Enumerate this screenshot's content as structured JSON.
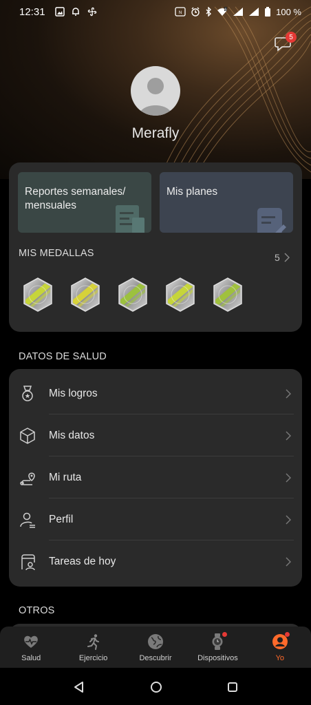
{
  "status_bar": {
    "time": "12:31",
    "battery": "100 %",
    "icons": [
      "gallery-icon",
      "notification-bell-icon",
      "fan-icon",
      "nfc-icon",
      "alarm-icon",
      "bluetooth-icon",
      "wifi-icon",
      "signal-icon",
      "battery-icon"
    ]
  },
  "messages": {
    "badge_count": "5"
  },
  "profile": {
    "name": "Merafly"
  },
  "tiles": {
    "reports_label": "Reportes semanales/ mensuales",
    "plans_label": "Mis planes"
  },
  "medals": {
    "title": "MIS MEDALLAS",
    "count": "5",
    "items": [
      {
        "name": "medal-1",
        "accent": "#c6d53a"
      },
      {
        "name": "medal-300",
        "accent": "#d6d23a"
      },
      {
        "name": "medal-100",
        "accent": "#9cc13e"
      },
      {
        "name": "medal-10",
        "accent": "#c6d53a"
      },
      {
        "name": "medal-1000",
        "accent": "#a0c13e"
      }
    ]
  },
  "health": {
    "title": "DATOS DE SALUD",
    "items": [
      {
        "label": "Mis logros",
        "icon": "medal-icon"
      },
      {
        "label": "Mis datos",
        "icon": "cube-icon"
      },
      {
        "label": "Mi ruta",
        "icon": "route-icon"
      },
      {
        "label": "Perfil",
        "icon": "person-icon"
      },
      {
        "label": "Tareas de hoy",
        "icon": "tasks-icon"
      }
    ]
  },
  "others": {
    "title": "OTROS"
  },
  "tabs": [
    {
      "label": "Salud",
      "icon": "heart-pulse-icon",
      "active": false
    },
    {
      "label": "Ejercicio",
      "icon": "running-icon",
      "active": false
    },
    {
      "label": "Descubrir",
      "icon": "globe-icon",
      "active": false
    },
    {
      "label": "Dispositivos",
      "icon": "watch-icon",
      "active": false,
      "dot": true
    },
    {
      "label": "Yo",
      "icon": "profile-icon",
      "active": true,
      "dot": true
    }
  ],
  "colors": {
    "accent": "#ff6a2b",
    "badge": "#e53935",
    "card": "#2a2a2a"
  }
}
